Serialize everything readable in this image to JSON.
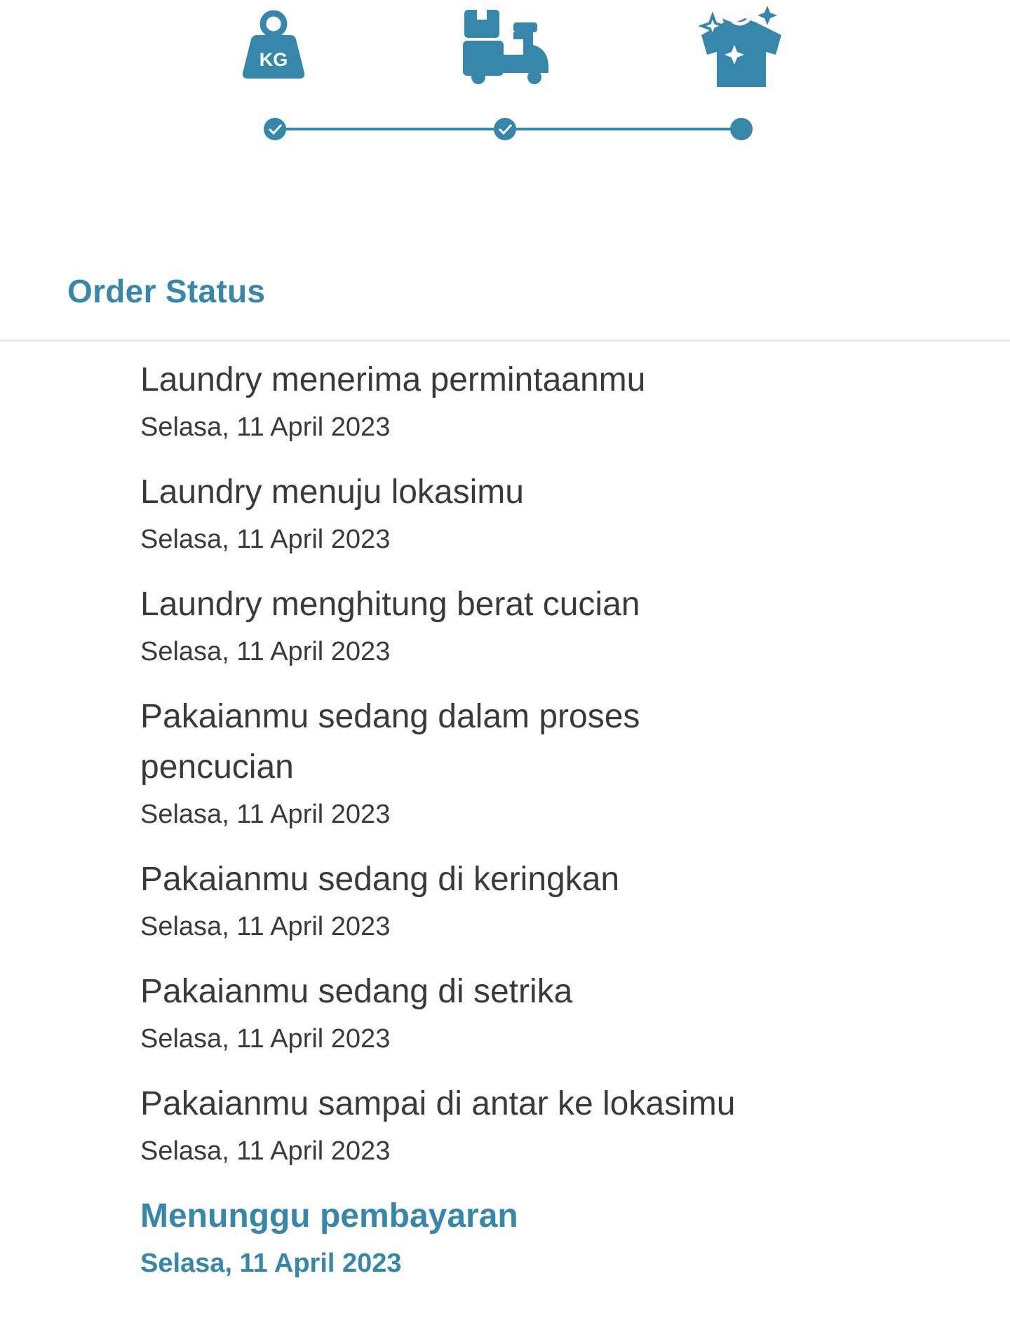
{
  "colors": {
    "accent": "#3687a9",
    "text": "#3a3a3a",
    "divider": "#ececec"
  },
  "steps": [
    {
      "icon": "weight-kg-icon",
      "label": "KG",
      "completed": true
    },
    {
      "icon": "delivery-scooter-icon",
      "completed": true
    },
    {
      "icon": "clean-shirt-icon",
      "completed": false,
      "current": true
    }
  ],
  "section": {
    "title": "Order Status"
  },
  "statuses": [
    {
      "text": "Laundry menerima permintaanmu",
      "date": "Selasa, 11 April 2023"
    },
    {
      "text": "Laundry menuju lokasimu",
      "date": "Selasa, 11 April 2023"
    },
    {
      "text": "Laundry menghitung berat cucian",
      "date": "Selasa, 11 April 2023"
    },
    {
      "text": "Pakaianmu sedang dalam proses pencucian",
      "date": "Selasa, 11 April 2023"
    },
    {
      "text": "Pakaianmu sedang di keringkan",
      "date": "Selasa, 11 April 2023"
    },
    {
      "text": "Pakaianmu sedang di setrika",
      "date": "Selasa, 11 April 2023"
    },
    {
      "text": "Pakaianmu sampai di antar ke lokasimu",
      "date": "Selasa, 11 April 2023"
    },
    {
      "text": "Menunggu pembayaran",
      "date": "Selasa, 11 April 2023",
      "active": true
    }
  ]
}
